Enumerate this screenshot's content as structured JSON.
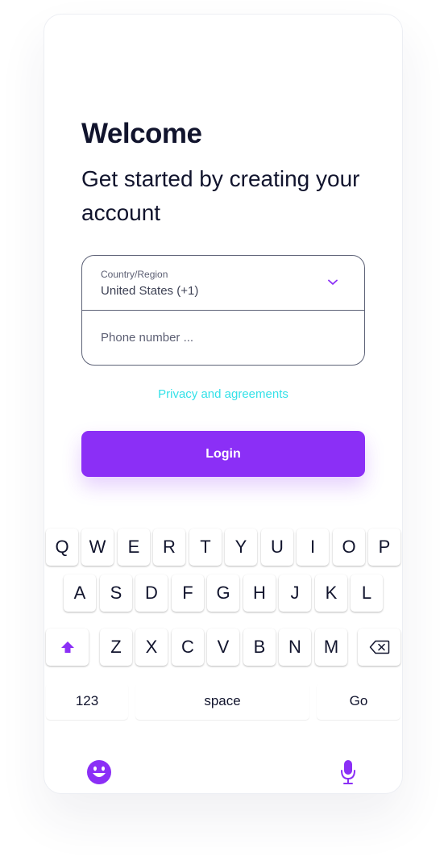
{
  "header": {
    "title": "Welcome",
    "subtitle": "Get started by creating your account"
  },
  "form": {
    "country_label": "Country/Region",
    "country_value": "United States (+1)",
    "phone_placeholder": "Phone number ..."
  },
  "links": {
    "privacy": "Privacy and agreements"
  },
  "actions": {
    "login": "Login"
  },
  "keyboard": {
    "row1": [
      "Q",
      "W",
      "E",
      "R",
      "T",
      "Y",
      "U",
      "I",
      "O",
      "P"
    ],
    "row2": [
      "A",
      "S",
      "D",
      "F",
      "G",
      "H",
      "J",
      "K",
      "L"
    ],
    "row3": [
      "Z",
      "X",
      "C",
      "V",
      "B",
      "N",
      "M"
    ],
    "numbers_label": "123",
    "space_label": "space",
    "go_label": "Go",
    "shift_icon": "shift-icon",
    "backspace_icon": "backspace-icon",
    "emoji_icon": "emoji-icon",
    "mic_icon": "microphone-icon"
  },
  "colors": {
    "accent": "#8b2ff6",
    "link": "#34e1e8",
    "text": "#11142d",
    "border": "#5d6277"
  }
}
